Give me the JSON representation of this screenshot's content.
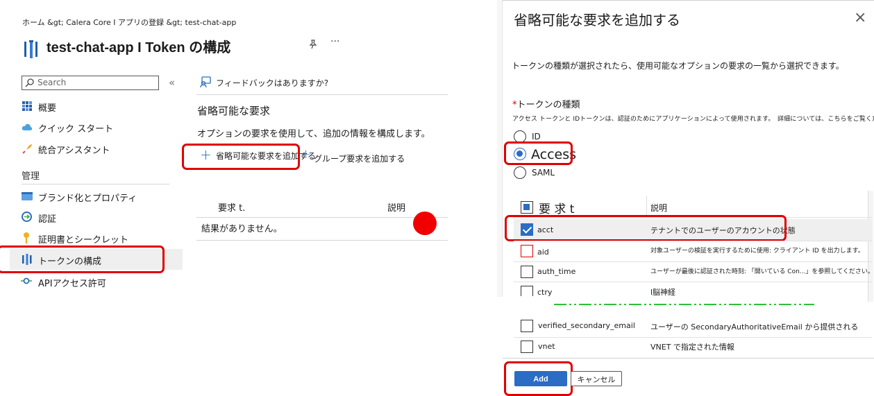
{
  "breadcrumb": "ホーム &gt; Calera Core I アプリの登録 &gt; test-chat-app",
  "page_title": "test-chat-app I Token の構成",
  "search": {
    "placeholder": "Search",
    "collapse": "«"
  },
  "sidebar": {
    "items": [
      {
        "label": "概要"
      },
      {
        "label": "クイック スタート"
      },
      {
        "label": "統合アシスタント"
      }
    ],
    "section": "管理",
    "manage_items": [
      {
        "label": "ブランド化とプロパティ"
      },
      {
        "label": "認証"
      },
      {
        "label": "証明書とシークレット"
      },
      {
        "label": "トークンの構成"
      },
      {
        "label": "APIアクセス許可"
      }
    ]
  },
  "main": {
    "feedback": "フィードバックはありますか?",
    "section_title": "省略可能な要求",
    "description": "オプションの要求を使用して、追加の情報を構成します。",
    "add_optional": "省略可能な要求を追加する",
    "add_group": "グループ要求を追加する",
    "col_claim": "要求 t.",
    "col_desc": "説明",
    "empty": "結果がありません。"
  },
  "panel": {
    "title": "省略可能な要求を追加する",
    "close": "×",
    "intro": "トークンの種類が選択されたら、使用可能なオプションの要求の一覧から選択できます。",
    "token_label_star": "*",
    "token_label": "トークンの種類",
    "token_help": "アクセス トークンと IDトークンは、認証のためにアプリケーションによって使用されます。　詳細については、こちらをご覧ください。",
    "radios": [
      {
        "label": "ID",
        "selected": false
      },
      {
        "label": "Access",
        "selected": true
      },
      {
        "label": "SAML",
        "selected": false
      }
    ],
    "col_claim": "要 求 t",
    "col_desc": "説明",
    "rows": [
      {
        "claim": "acct",
        "desc": "テナントでのユーザーのアカウントの状態",
        "checked": true
      },
      {
        "claim": "aid",
        "desc": "対象ユーザーの検証を実行するために使用: クライアント ID を出力します。",
        "checked": false
      },
      {
        "claim": "auth_time",
        "desc": "ユーザーが最後に認証された時刻: 「開いている Con...」を参照してください。",
        "checked": false
      },
      {
        "claim": "ctry",
        "desc": "l脳神経",
        "checked": false
      },
      {
        "claim": "verified_secondary_email",
        "desc": "ユーザーの SecondaryAuthoritativeEmail から提供される",
        "checked": false
      },
      {
        "claim": "vnet",
        "desc": "VNET で指定された情報",
        "checked": false
      }
    ],
    "add_button": "Add",
    "cancel_button": "キャンセル"
  },
  "colors": {
    "accent": "#2b6cc4",
    "highlight": "#e00000",
    "selected_row": "#efefef"
  }
}
